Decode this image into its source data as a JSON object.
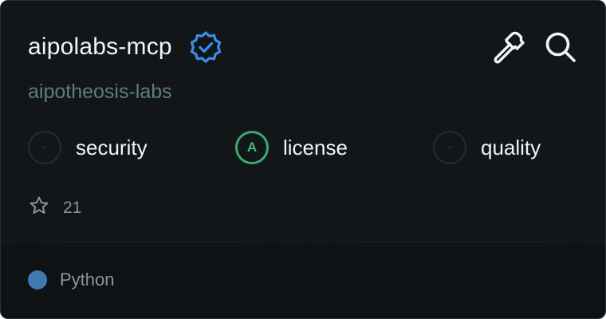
{
  "card": {
    "title": "aipolabs-mcp",
    "owner": "aipotheosis-labs",
    "verified_icon": "verified-badge-icon",
    "actions": [
      {
        "icon": "hammer-icon",
        "name": "tools-button"
      },
      {
        "icon": "search-icon",
        "name": "search-button"
      }
    ],
    "scores": [
      {
        "grade": "-",
        "label": "security"
      },
      {
        "grade": "A",
        "label": "license"
      },
      {
        "grade": "-",
        "label": "quality"
      }
    ],
    "stars": {
      "icon": "star-icon",
      "count": "21"
    },
    "language": {
      "name": "Python",
      "color": "#3f79b0"
    }
  },
  "colors": {
    "background": "#121619",
    "footer_background": "#0e1215",
    "verified_blue": "#3b8de8",
    "grade_a_green": "#3aa870",
    "owner_text": "#5f7d7c"
  }
}
